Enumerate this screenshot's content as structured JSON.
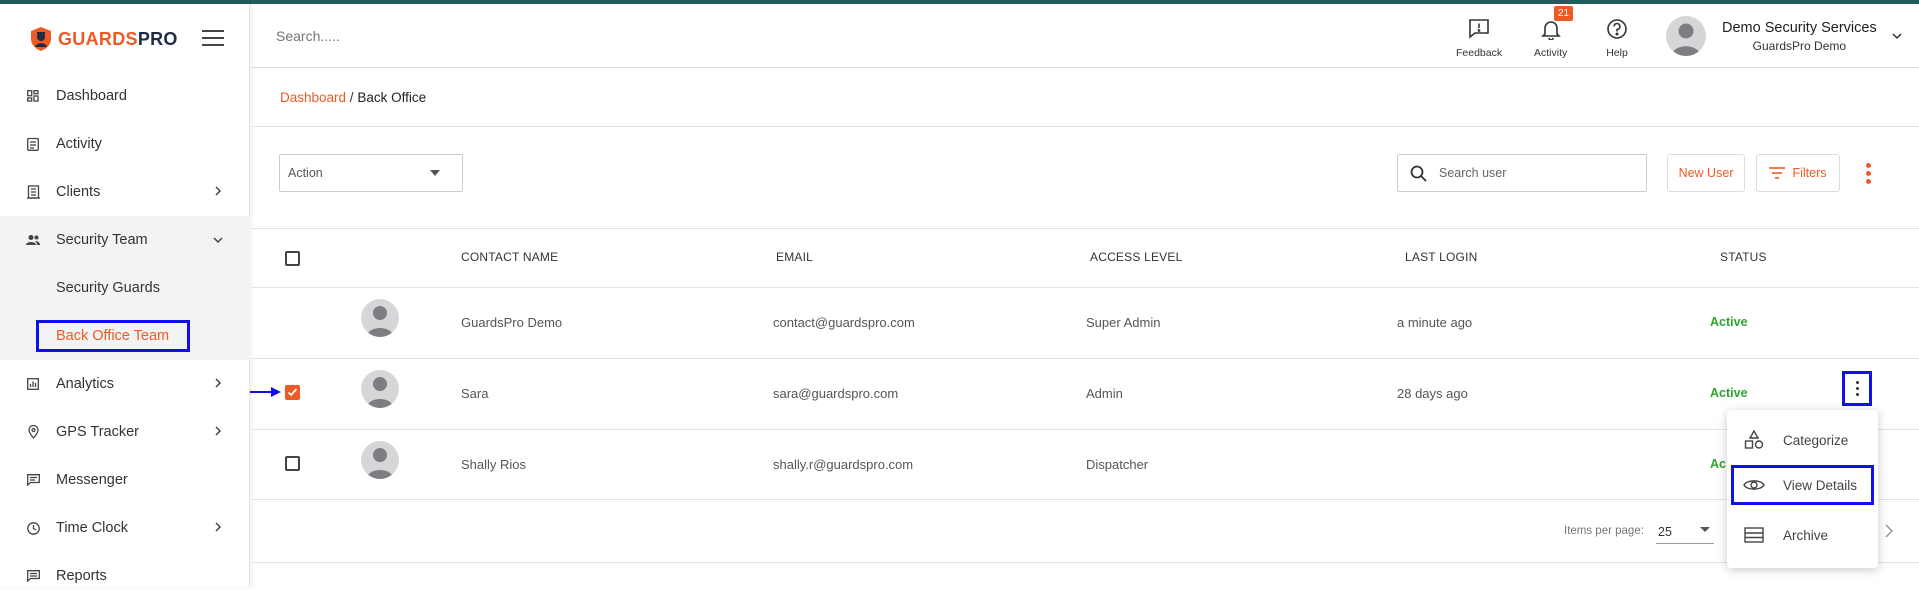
{
  "brand": {
    "name_part1": "GUARDS",
    "name_part2": "PRO",
    "accent": "#ef5a24",
    "highlight": "#1010e8"
  },
  "sidebar": {
    "items": [
      {
        "label": "Dashboard",
        "icon": "dashboard-icon"
      },
      {
        "label": "Activity",
        "icon": "clipboard-icon"
      },
      {
        "label": "Clients",
        "icon": "building-icon"
      },
      {
        "label": "Security Team",
        "icon": "people-icon"
      },
      {
        "label": "Analytics",
        "icon": "chart-icon"
      },
      {
        "label": "GPS Tracker",
        "icon": "location-pin-icon"
      },
      {
        "label": "Messenger",
        "icon": "message-icon"
      },
      {
        "label": "Time Clock",
        "icon": "clock-icon"
      },
      {
        "label": "Reports",
        "icon": "report-icon"
      }
    ],
    "sub_items": [
      {
        "label": "Security Guards"
      },
      {
        "label": "Back Office Team"
      }
    ]
  },
  "header": {
    "search_placeholder": "Search.....",
    "feedback_label": "Feedback",
    "activity_label": "Activity",
    "activity_count": "21",
    "help_label": "Help",
    "user_name": "Demo Security Services",
    "user_sub": "GuardsPro Demo"
  },
  "breadcrumb": {
    "root": "Dashboard",
    "separator": " / ",
    "current": "Back Office"
  },
  "toolbar": {
    "action_label": "Action",
    "search_placeholder": "Search user",
    "new_user_label": "New User",
    "filters_label": "Filters"
  },
  "table": {
    "columns": [
      "CONTACT NAME",
      "EMAIL",
      "ACCESS LEVEL",
      "LAST LOGIN",
      "STATUS"
    ],
    "rows": [
      {
        "name": "GuardsPro Demo",
        "email": "contact@guardspro.com",
        "access": "Super Admin",
        "last_login": "a minute ago",
        "status": "Active",
        "checked": false
      },
      {
        "name": "Sara",
        "email": "sara@guardspro.com",
        "access": "Admin",
        "last_login": "28 days ago",
        "status": "Active",
        "checked": true
      },
      {
        "name": "Shally Rios",
        "email": "shally.r@guardspro.com",
        "access": "Dispatcher",
        "last_login": "",
        "status": "Ac",
        "checked": false
      }
    ]
  },
  "pagination": {
    "label": "Items per page:",
    "value": "25"
  },
  "context_menu": {
    "items": [
      {
        "label": "Categorize",
        "icon": "shapes-icon"
      },
      {
        "label": "View Details",
        "icon": "eye-icon"
      },
      {
        "label": "Archive",
        "icon": "archive-icon"
      }
    ]
  }
}
